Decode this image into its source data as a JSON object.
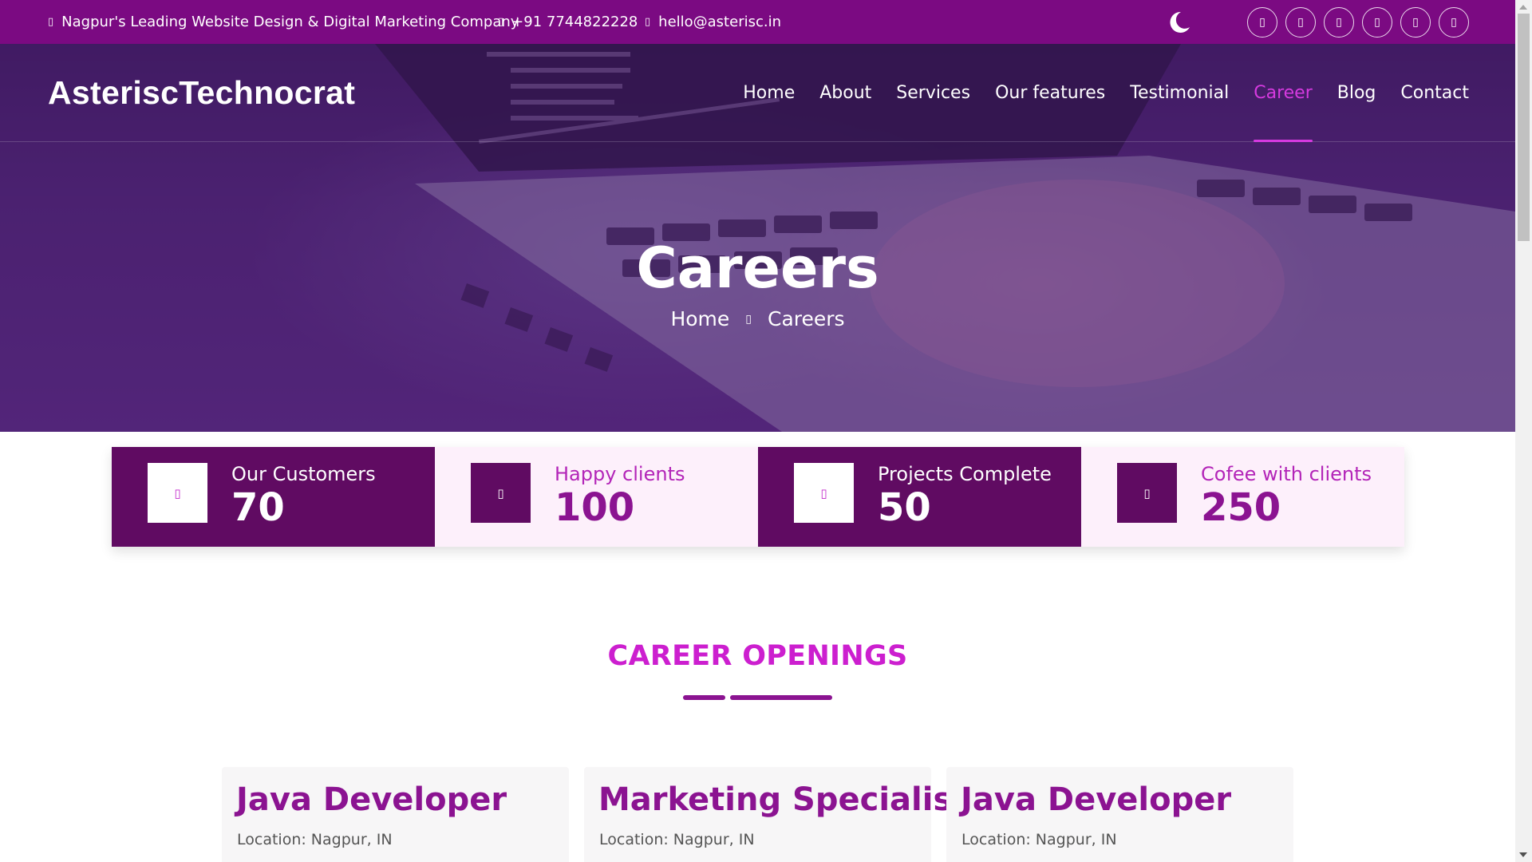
{
  "colors": {
    "topbar": "#7b0a82",
    "accent": "#d63ae0",
    "dark_purple": "#600b62",
    "light_pink": "#fdf0fb",
    "title_purple": "#8b1391",
    "section_title": "#cc1fcf"
  },
  "topbar": {
    "tagline": "Nagpur's Leading Website Design & Digital Marketing Company",
    "phone": "+91 7744822228",
    "email": "hello@asterisc.in",
    "icons": [
      "map-marker-icon",
      "phone-icon",
      "envelope-icon"
    ],
    "theme_toggle_icon": "moon-icon",
    "socials": [
      "facebook-icon",
      "twitter-icon",
      "linkedin-icon",
      "instagram-icon",
      "youtube-icon",
      "whatsapp-icon"
    ]
  },
  "header": {
    "brand": "AsteriscTechnocrat",
    "nav": [
      "Home",
      "About",
      "Services",
      "Our features",
      "Testimonial",
      "Career",
      "Blog",
      "Contact"
    ],
    "active": "Career"
  },
  "hero": {
    "title": "Careers",
    "breadcrumb": [
      "Home",
      "Careers"
    ],
    "separator_icon": "chevron-right-icon"
  },
  "stats": [
    {
      "label": "Our Customers",
      "value": "70",
      "icon": "users-icon"
    },
    {
      "label": "Happy clients",
      "value": "100",
      "icon": "smile-icon"
    },
    {
      "label": "Projects Complete",
      "value": "50",
      "icon": "briefcase-icon"
    },
    {
      "label": "Cofee with clients",
      "value": "250",
      "icon": "coffee-icon"
    }
  ],
  "section": {
    "title": "CAREER OPENINGS"
  },
  "jobs": [
    {
      "title": "Java Developer",
      "location": "Location: Nagpur, IN"
    },
    {
      "title": "Marketing Specialist",
      "location": "Location: Nagpur, IN"
    },
    {
      "title": "Java Developer",
      "location": "Location: Nagpur, IN"
    }
  ]
}
